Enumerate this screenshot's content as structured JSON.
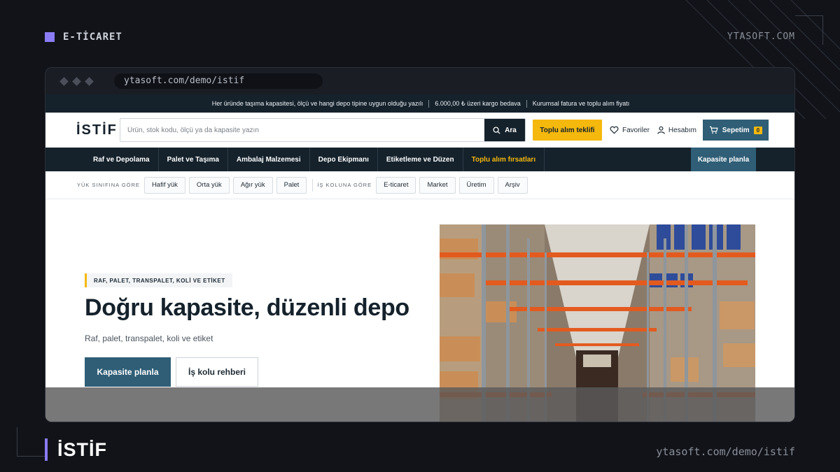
{
  "slide": {
    "tag": "E-TİCARET",
    "brand": "YTASOFT.COM",
    "title": "İSTİF",
    "url": "ytasoft.com/demo/istif"
  },
  "browser": {
    "url": "ytasoft.com/demo/istif"
  },
  "announcement": [
    "Her üründe taşıma kapasitesi, ölçü ve hangi depo tipine uygun olduğu yazılı",
    "6.000,00 ₺ üzeri kargo bedava",
    "Kurumsal fatura ve toplu alım fiyatı"
  ],
  "header": {
    "logo": "İSTİF",
    "search_placeholder": "Ürün, stok kodu, ölçü ya da kapasite yazın",
    "search_button": "Ara",
    "bulk_quote": "Toplu alım teklifi",
    "favorites": "Favoriler",
    "account": "Hesabım",
    "cart_label": "Sepetim",
    "cart_count": "0"
  },
  "nav": {
    "items": [
      "Raf ve Depolama",
      "Palet ve Taşıma",
      "Ambalaj Malzemesi",
      "Depo Ekipmanı",
      "Etiketleme ve Düzen"
    ],
    "deals": "Toplu alım fırsatları",
    "cta": "Kapasite planla"
  },
  "filters": {
    "load_label": "YÜK SINIFINA GÖRE",
    "load_chips": [
      "Hafif yük",
      "Orta yük",
      "Ağır yük",
      "Palet"
    ],
    "business_label": "İŞ KOLUNA GÖRE",
    "business_chips": [
      "E-ticaret",
      "Market",
      "Üretim",
      "Arşiv"
    ]
  },
  "hero": {
    "eyebrow": "RAF, PALET, TRANSPALET, KOLİ VE ETİKET",
    "title": "Doğru kapasite, düzenli depo",
    "subtitle": "Raf, palet, transpalet, koli ve etiket",
    "primary_button": "Kapasite planla",
    "secondary_button": "İş kolu rehberi"
  },
  "colors": {
    "dark_navy": "#15222c",
    "teal": "#2f5e76",
    "yellow": "#f5b80d",
    "purple_accent": "#8b7cf6"
  }
}
